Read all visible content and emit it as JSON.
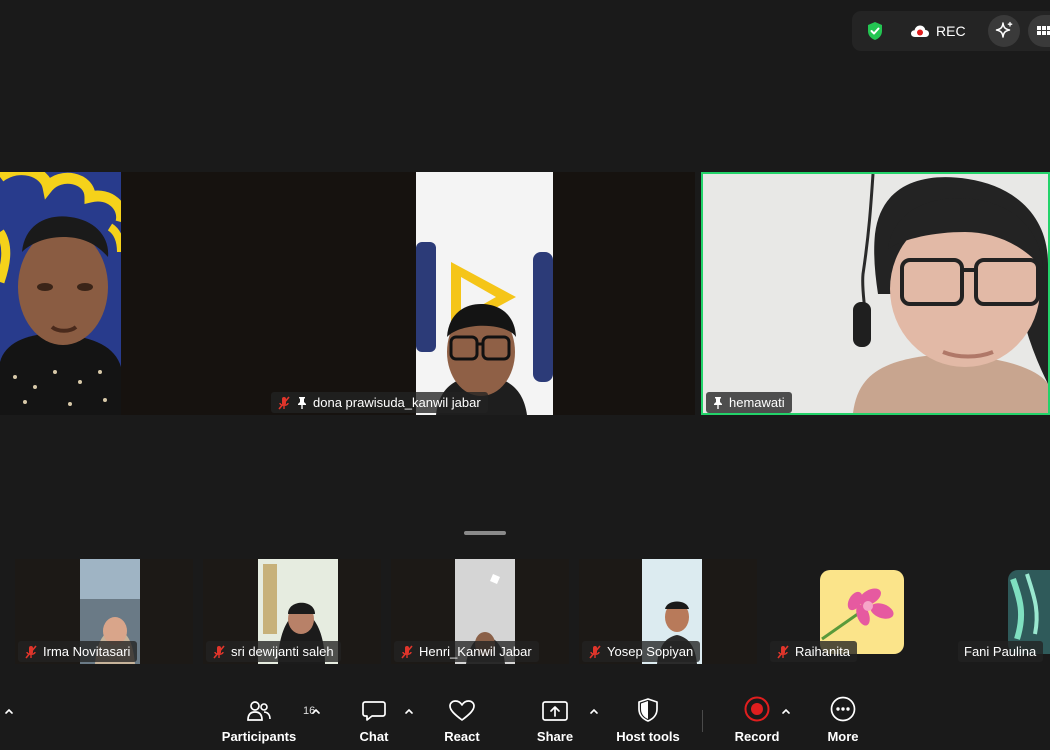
{
  "top_bar": {
    "rec_label": "REC",
    "security_icon": "shield-check-icon",
    "ai_icon": "sparkle-icon",
    "view_icon": "grid-view-icon"
  },
  "main_tiles": [
    {
      "name": "",
      "muted": false,
      "pinned": false
    },
    {
      "name": "dona prawisuda_kanwil jabar",
      "muted": true,
      "pinned": true
    },
    {
      "name": "hemawati",
      "muted": false,
      "pinned": true,
      "active_speaker": true
    }
  ],
  "thumbnails": [
    {
      "name": "Irma Novitasari",
      "muted": true
    },
    {
      "name": "sri dewijanti saleh",
      "muted": true
    },
    {
      "name": "Henri_Kanwil Jabar",
      "muted": true
    },
    {
      "name": "Yosep Sopiyan",
      "muted": true
    },
    {
      "name": "Raihanita",
      "muted": true
    },
    {
      "name": "Fani Paulina",
      "muted": false
    }
  ],
  "toolbar": {
    "participants_label": "Participants",
    "participants_count": "16",
    "chat_label": "Chat",
    "react_label": "React",
    "share_label": "Share",
    "host_tools_label": "Host tools",
    "record_label": "Record",
    "more_label": "More"
  },
  "colors": {
    "active_speaker_border": "#23d36a",
    "mute_red": "#e0352b",
    "record_red": "#e01e1e",
    "background": "#1a1a1a"
  }
}
